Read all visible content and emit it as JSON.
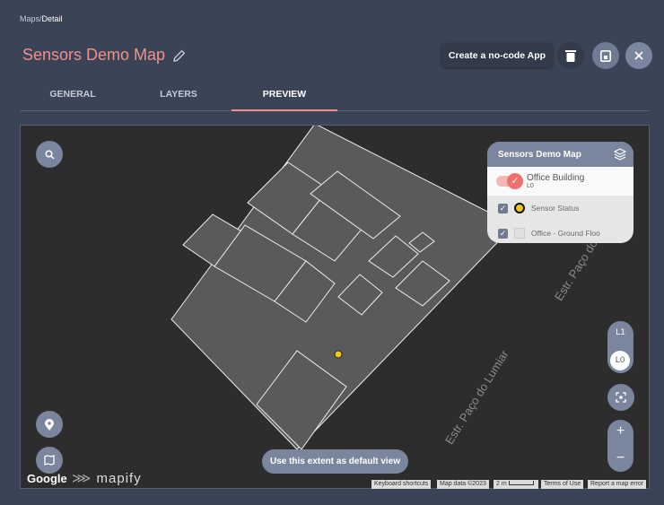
{
  "breadcrumb": {
    "parent": "Maps",
    "separator": "/",
    "current": "Detail"
  },
  "header": {
    "title": "Sensors Demo Map",
    "create_app_label": "Create a no-code App"
  },
  "tabs": [
    {
      "label": "GENERAL"
    },
    {
      "label": "LAYERS"
    },
    {
      "label": "PREVIEW",
      "active": true
    }
  ],
  "map": {
    "road_label": "Estr. Paço do Lumiar",
    "road_label_partial": "Estr. Paço do Lumiar",
    "extent_button": "Use this extent as default view",
    "google_logo": "Google",
    "mapify_logo": "mapify",
    "floors": [
      "L1",
      "L0"
    ],
    "active_floor": "L0",
    "zoom_in": "+",
    "zoom_out": "−",
    "attribution": {
      "keyboard": "Keyboard shortcuts",
      "data": "Map data ©2023",
      "scale": "2 m",
      "terms": "Terms of Use",
      "report": "Report a map error"
    }
  },
  "legend": {
    "title": "Sensors Demo Map",
    "building": "Office Building",
    "building_level": "L0",
    "layers": [
      {
        "label": "Sensor Status",
        "checked": true,
        "color": "#f5c518"
      },
      {
        "label": "Office - Ground Floo",
        "checked": true,
        "color": "#e0e0e0"
      }
    ]
  },
  "colors": {
    "accent": "#f0908e",
    "bg": "#3b4456",
    "button": "#7a859e"
  }
}
